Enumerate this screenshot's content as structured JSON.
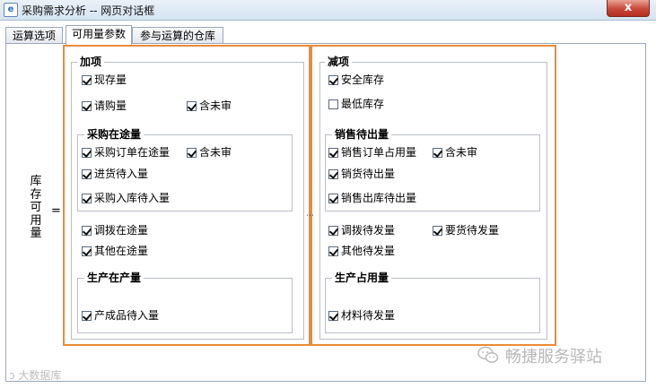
{
  "window": {
    "title": "采购需求分析 -- 网页对话框",
    "close_glyph": "x"
  },
  "tabs": [
    {
      "label": "运算选项"
    },
    {
      "label": "可用量参数"
    },
    {
      "label": "参与运算的仓库"
    }
  ],
  "formula": {
    "label_chars": [
      "库",
      "存",
      "可",
      "用",
      "量"
    ],
    "equals": "="
  },
  "left": {
    "title": "加项",
    "items": {
      "on_hand": {
        "label": "现存量",
        "checked": true
      },
      "requisition": {
        "label": "请购量",
        "checked": true
      },
      "requisition_unaudited": {
        "label": "含未审",
        "checked": true
      }
    },
    "purchase_in_transit": {
      "title": "采购在途量",
      "po_in_transit": {
        "label": "采购订单在途量",
        "checked": true
      },
      "po_unaudited": {
        "label": "含未审",
        "checked": true
      },
      "arrival_pending": {
        "label": "进货待入量",
        "checked": true
      },
      "purchase_receipt_pending": {
        "label": "采购入库待入量",
        "checked": true
      }
    },
    "transfer_in_transit": {
      "label": "调拨在途量",
      "checked": true
    },
    "other_in_transit": {
      "label": "其他在途量",
      "checked": true
    },
    "production": {
      "title": "生产在产量",
      "finished_goods_pending": {
        "label": "产成品待入量",
        "checked": true
      }
    }
  },
  "right": {
    "title": "减项",
    "safety_stock": {
      "label": "安全库存",
      "checked": true
    },
    "min_stock": {
      "label": "最低库存",
      "checked": false
    },
    "sales_pending": {
      "title": "销售待出量",
      "so_occupied": {
        "label": "销售订单占用量",
        "checked": true
      },
      "so_unaudited": {
        "label": "含未审",
        "checked": true
      },
      "delivery_pending": {
        "label": "销货待出量",
        "checked": true
      },
      "sales_issue_pending": {
        "label": "销售出库待出量",
        "checked": true
      }
    },
    "transfer_pending": {
      "label": "调拨待发量",
      "checked": true
    },
    "requested_pending": {
      "label": "要货待发量",
      "checked": true
    },
    "other_pending": {
      "label": "其他待发量",
      "checked": true
    },
    "production_use": {
      "title": "生产占用量",
      "material_pending": {
        "label": "材料待发量",
        "checked": true
      }
    }
  },
  "separator_dots": "⋯",
  "watermark": {
    "text": "畅捷服务驿站",
    "corner_text": "大数据库"
  },
  "colors": {
    "highlight": "#ed8a38"
  }
}
